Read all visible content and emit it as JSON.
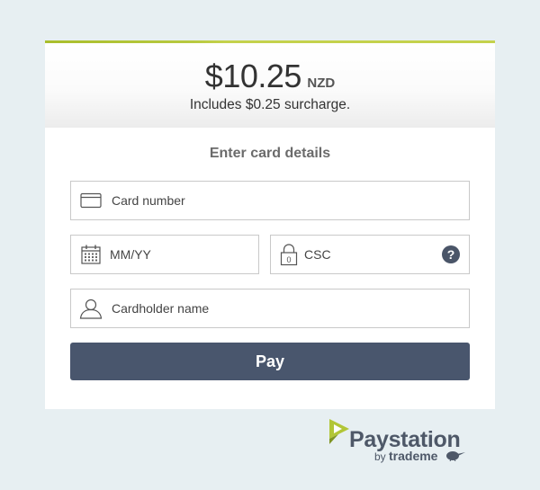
{
  "payment": {
    "amount": "$10.25",
    "currency": "NZD",
    "surcharge_text": "Includes $0.25 surcharge."
  },
  "form": {
    "title": "Enter card details",
    "card_number_placeholder": "Card number",
    "expiry_placeholder": "MM/YY",
    "csc_placeholder": "CSC",
    "csc_help": "?",
    "cardholder_placeholder": "Cardholder name",
    "pay_label": "Pay"
  },
  "branding": {
    "name": "Paystation",
    "by": "by",
    "partner": "trademe"
  },
  "icons": {
    "card": "credit-card-icon",
    "calendar": "calendar-icon",
    "lock": "lock-icon",
    "help": "help-icon",
    "user": "user-icon",
    "logo": "paystation-logo-icon",
    "kiwi": "kiwi-icon"
  },
  "colors": {
    "accent_stripe": "#c4d24c",
    "pay_button": "#49566d",
    "background": "#e7eff2",
    "brand_text": "#4e5868",
    "brand_green": "#a9be2c"
  }
}
